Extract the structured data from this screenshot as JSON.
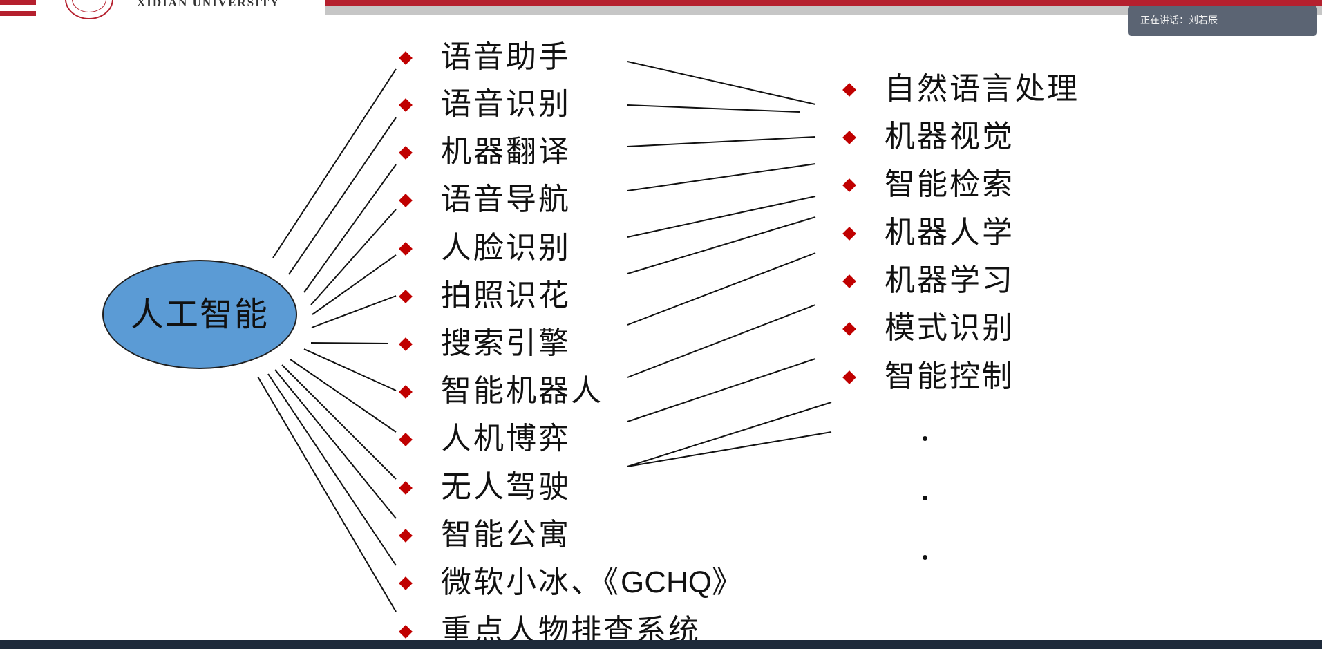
{
  "header": {
    "university_name": "XIDIAN UNIVERSITY",
    "speaker_status": "正在讲话：刘若辰",
    "colors": {
      "accent_red": "#b5202e",
      "band_grey": "#c6c6c6"
    }
  },
  "diagram": {
    "center_label": "人工智能",
    "center_color": "#5b9bd5",
    "bullet_color": "#c00000",
    "applications": [
      "语音助手",
      "语音识别",
      "机器翻译",
      "语音导航",
      "人脸识别",
      "拍照识花",
      "搜索引擎",
      "智能机器人",
      "人机博弈",
      "无人驾驶",
      "智能公寓"
    ],
    "application_xiaoice_prefix": "微软小冰、《",
    "application_xiaoice_latin": "GCHQ",
    "application_xiaoice_suffix": "》",
    "application_last": "重点人物排查系统",
    "technologies": [
      "自然语言处理",
      "机器视觉",
      "智能检索",
      "机器人学",
      "机器学习",
      "模式识别",
      "智能控制"
    ]
  }
}
